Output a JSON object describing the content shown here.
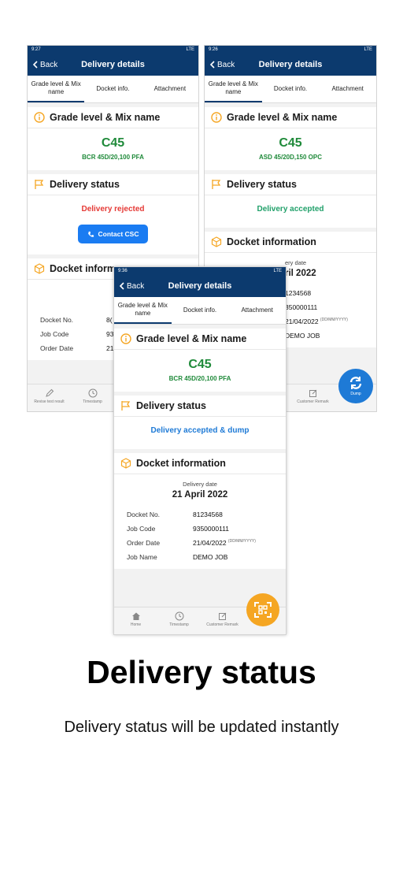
{
  "nav": {
    "back": "Back",
    "title": "Delivery details"
  },
  "tabs": {
    "grade": "Grade level & Mix name",
    "docket": "Docket info.",
    "attachment": "Attachment"
  },
  "sections": {
    "grade": "Grade level & Mix name",
    "status": "Delivery status",
    "docket": "Docket information"
  },
  "phone1": {
    "time": "9:27",
    "network": "LTE",
    "grade": "C45",
    "mix": "BCR 45D/20,100 PFA",
    "status": "Delivery rejected",
    "contact": "Contact CSC",
    "docket_head": "Docket inform",
    "date_label": "Delive",
    "date": "21 Apr",
    "rows": [
      {
        "k": "Docket No.",
        "v": "8("
      },
      {
        "k": "Job Code",
        "v": "93"
      },
      {
        "k": "Order Date",
        "v": "21"
      }
    ],
    "bottom": [
      "Revise test result",
      "Timestamp"
    ]
  },
  "phone2": {
    "time": "9:26",
    "network": "LTE",
    "grade": "C45",
    "mix": "ASD 45/20D,150 OPC",
    "status": "Delivery accepted",
    "date_label": "ery date",
    "date": "ril 2022",
    "rows": [
      {
        "v": "1234568"
      },
      {
        "v": "350000111"
      },
      {
        "v": "21/04/2022",
        "f": "(DD/MM/YYYY)"
      },
      {
        "v": "DEMO JOB"
      }
    ],
    "bottom": [
      "Customer Remark"
    ],
    "fab": "Dump"
  },
  "phone3": {
    "time": "9:36",
    "network": "LTE",
    "grade": "C45",
    "mix": "BCR 45D/20,100 PFA",
    "status": "Delivery accepted & dump",
    "date_label": "Delivery date",
    "date": "21 April 2022",
    "rows": [
      {
        "k": "Docket No.",
        "v": "81234568"
      },
      {
        "k": "Job Code",
        "v": "9350000111"
      },
      {
        "k": "Order Date",
        "v": "21/04/2022",
        "f": "(DD/MM/YYYY)"
      },
      {
        "k": "Job Name",
        "v": "DEMO JOB"
      }
    ],
    "bottom": [
      "Home",
      "Timestamp",
      "Customer Remark"
    ]
  },
  "headline": "Delivery status",
  "subtitle": "Delivery status will be updated instantly",
  "colors": {
    "navy": "#0c3a6e",
    "green": "#1f8a3a",
    "red": "#e53935",
    "blue": "#1e7ad6",
    "orange": "#f5a623"
  }
}
